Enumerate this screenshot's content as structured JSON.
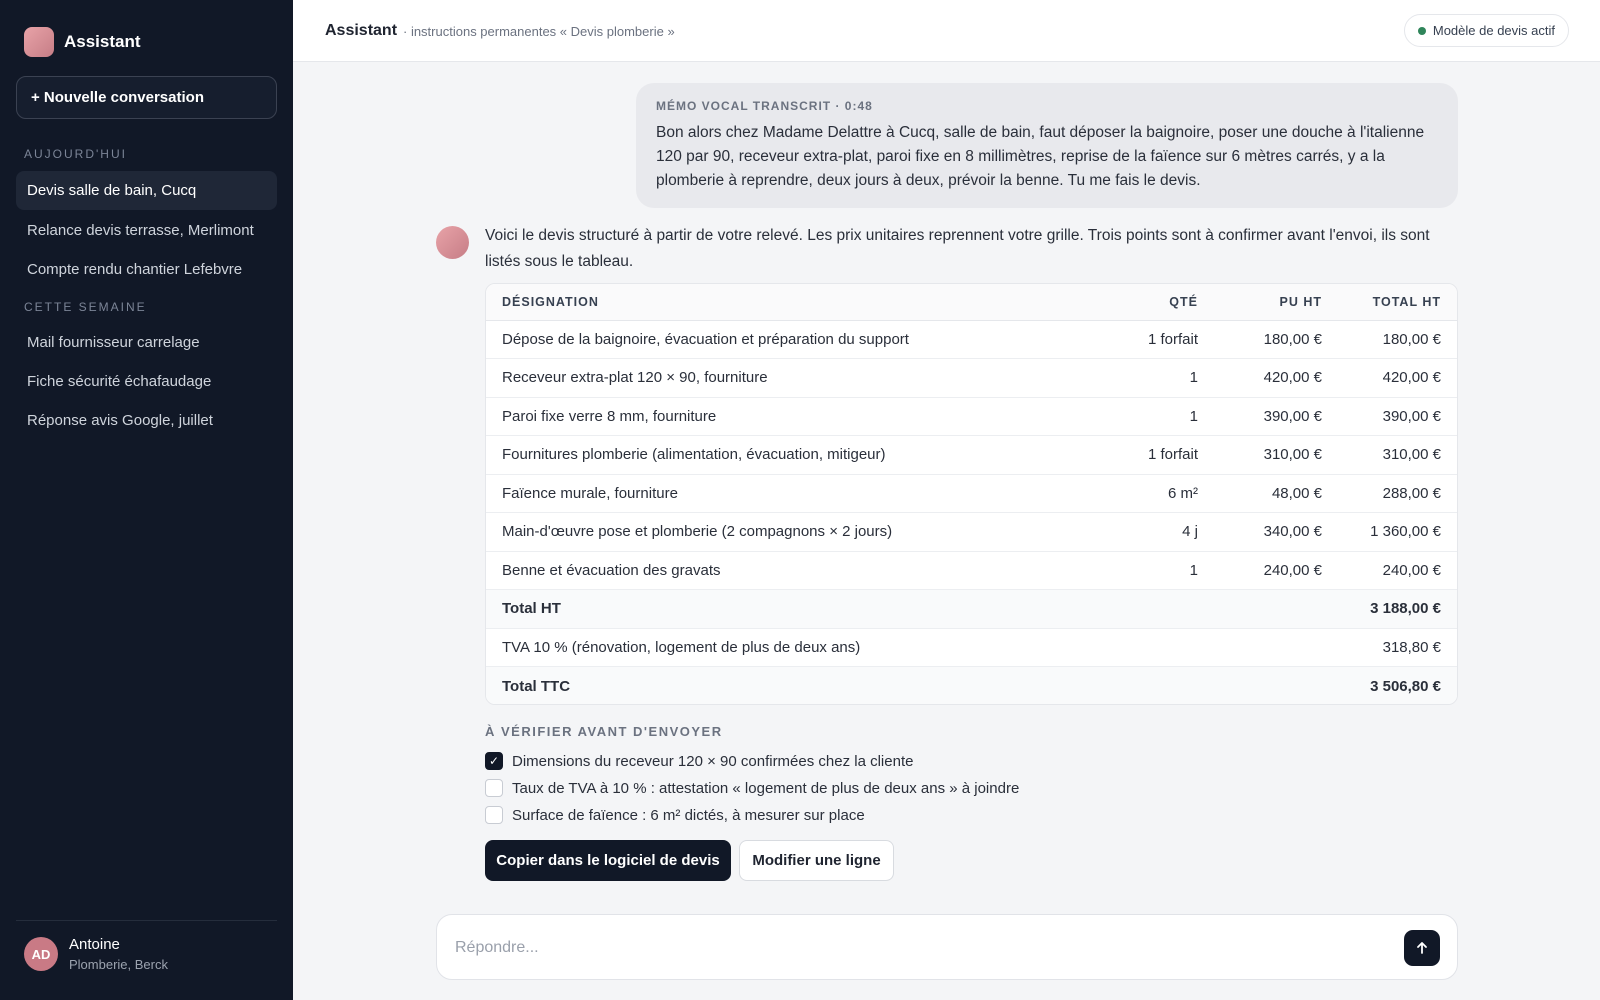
{
  "sidebar": {
    "brand": "Assistant",
    "new_conversation": "+ Nouvelle conversation",
    "sections": [
      {
        "label": "AUJOURD'HUI",
        "items": [
          {
            "label": "Devis salle de bain, Cucq",
            "active": true
          },
          {
            "label": "Relance devis terrasse, Merlimont",
            "active": false
          },
          {
            "label": "Compte rendu chantier Lefebvre",
            "active": false
          }
        ]
      },
      {
        "label": "CETTE SEMAINE",
        "items": [
          {
            "label": "Mail fournisseur carrelage",
            "active": false
          },
          {
            "label": "Fiche sécurité échafaudage",
            "active": false
          },
          {
            "label": "Réponse avis Google, juillet",
            "active": false
          }
        ]
      }
    ],
    "user": {
      "initials": "AD",
      "name": "Antoine",
      "subtitle": "Plomberie, Berck"
    }
  },
  "header": {
    "title": "Assistant",
    "subtitle": "· instructions permanentes « Devis plomberie »",
    "status": "Modèle de devis actif"
  },
  "memo": {
    "label": "MÉMO VOCAL TRANSCRIT · 0:48",
    "text": "Bon alors chez Madame Delattre à Cucq, salle de bain, faut déposer la baignoire, poser une douche à l'italienne 120 par 90, receveur extra-plat, paroi fixe en 8 millimètres, reprise de la faïence sur 6 mètres carrés, y a la plomberie à reprendre, deux jours à deux, prévoir la benne. Tu me fais le devis."
  },
  "assistant": {
    "intro": "Voici le devis structuré à partir de votre relevé. Les prix unitaires reprennent votre grille. Trois points sont à confirmer avant l'envoi, ils sont listés sous le tableau."
  },
  "quote": {
    "headers": {
      "designation": "DÉSIGNATION",
      "qty": "QTÉ",
      "pu": "PU HT",
      "total": "TOTAL HT"
    },
    "rows": [
      {
        "designation": "Dépose de la baignoire, évacuation et préparation du support",
        "qty": "1 forfait",
        "pu": "180,00 €",
        "total": "180,00 €"
      },
      {
        "designation": "Receveur extra-plat 120 × 90, fourniture",
        "qty": "1",
        "pu": "420,00 €",
        "total": "420,00 €"
      },
      {
        "designation": "Paroi fixe verre 8 mm, fourniture",
        "qty": "1",
        "pu": "390,00 €",
        "total": "390,00 €"
      },
      {
        "designation": "Fournitures plomberie (alimentation, évacuation, mitigeur)",
        "qty": "1 forfait",
        "pu": "310,00 €",
        "total": "310,00 €"
      },
      {
        "designation": "Faïence murale, fourniture",
        "qty": "6 m²",
        "pu": "48,00 €",
        "total": "288,00 €"
      },
      {
        "designation": "Main-d'œuvre pose et plomberie (2 compagnons × 2 jours)",
        "qty": "4 j",
        "pu": "340,00 €",
        "total": "1 360,00 €"
      },
      {
        "designation": "Benne et évacuation des gravats",
        "qty": "1",
        "pu": "240,00 €",
        "total": "240,00 €"
      }
    ],
    "total_ht": {
      "label": "Total HT",
      "value": "3 188,00 €"
    },
    "tva": {
      "label": "TVA 10 % (rénovation, logement de plus de deux ans)",
      "value": "318,80 €"
    },
    "total_ttc": {
      "label": "Total TTC",
      "value": "3 506,80 €"
    }
  },
  "verify": {
    "title": "À VÉRIFIER AVANT D'ENVOYER",
    "items": [
      {
        "label": "Dimensions du receveur 120 × 90 confirmées chez la cliente",
        "checked": true
      },
      {
        "label": "Taux de TVA à 10 % : attestation « logement de plus de deux ans » à joindre",
        "checked": false
      },
      {
        "label": "Surface de faïence : 6 m² dictés, à mesurer sur place",
        "checked": false
      }
    ]
  },
  "actions": {
    "copy": "Copier dans le logiciel de devis",
    "edit": "Modifier une ligne"
  },
  "composer": {
    "placeholder": "Répondre...",
    "value": ""
  },
  "colors": {
    "sidebar_bg": "#111827",
    "accent": "#111827",
    "status_green": "#2f855a",
    "avatar": "#c97a85"
  }
}
